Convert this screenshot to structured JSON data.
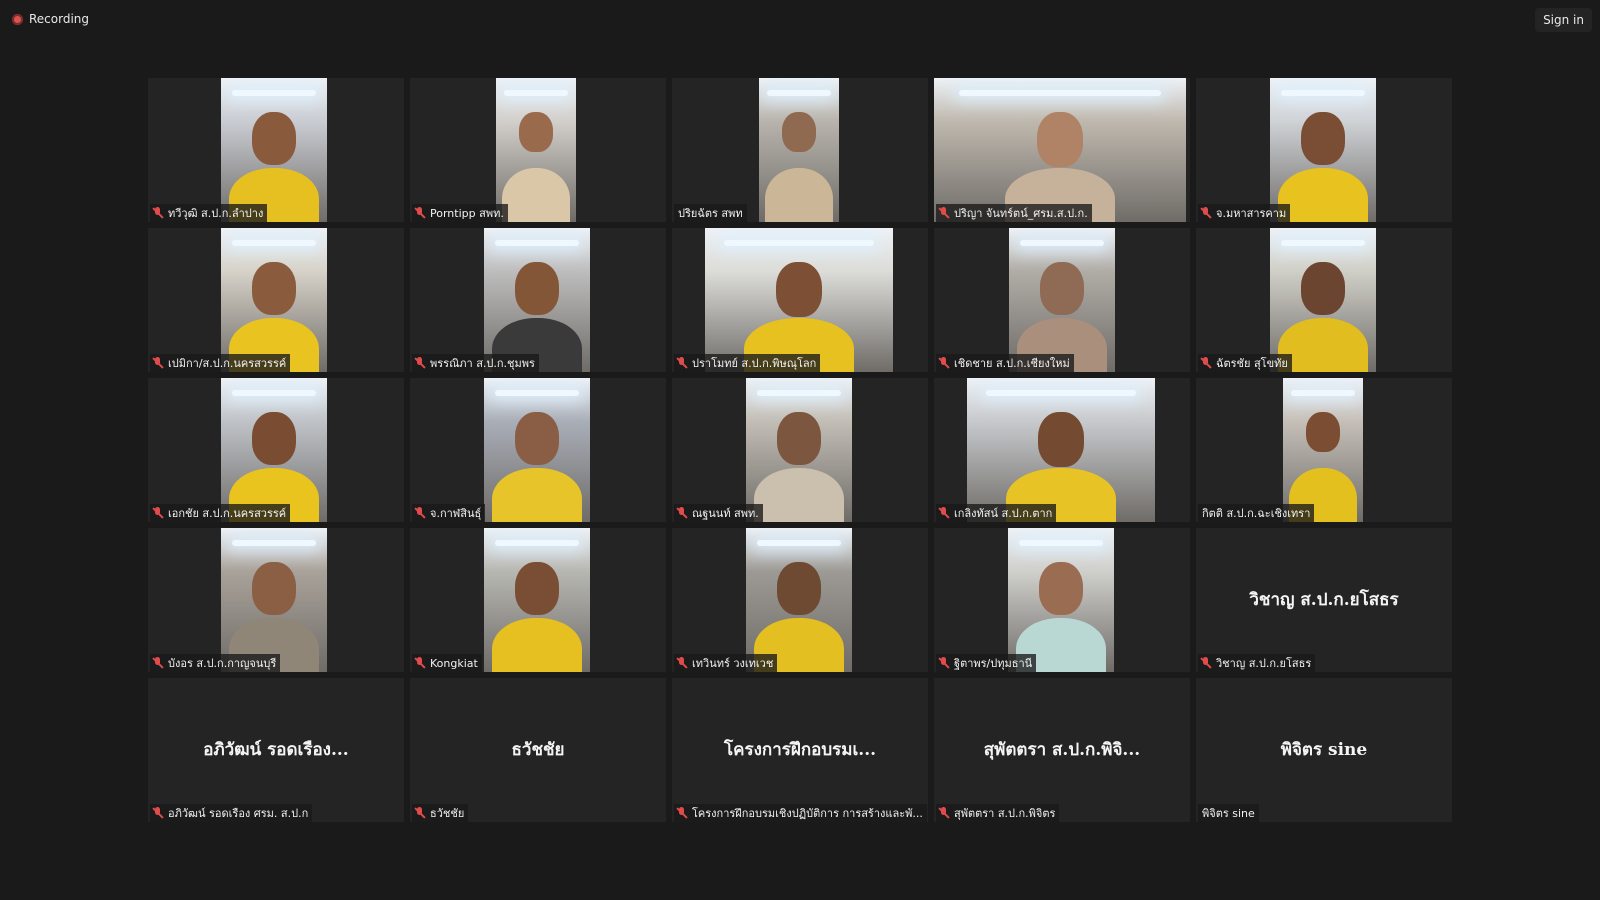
{
  "topbar": {
    "recording_label": "Recording",
    "signin_label": "Sign in"
  },
  "colors": {
    "background": "#1a1a1a",
    "tile": "#242424",
    "mic_muted": "#e04b4b",
    "shirt": "#e6c020"
  },
  "participants": [
    {
      "name": "ทวีวุฒิ ส.ป.ก.ลำปาง",
      "muted": true,
      "video": true
    },
    {
      "name": "Porntipp สพท.",
      "muted": true,
      "video": true
    },
    {
      "name": "ปริยฉัตร สพท",
      "muted": false,
      "video": true
    },
    {
      "name": "ปริญา จันทร์ตน์_ศรม.ส.ป.ก.",
      "muted": true,
      "video": true
    },
    {
      "name": "จ.มหาสารคาม",
      "muted": true,
      "video": true
    },
    {
      "name": "เปมิกา/ส.ป.ก.นครสวรรค์",
      "muted": true,
      "video": true
    },
    {
      "name": "พรรณิภา ส.ป.ก.ชุมพร",
      "muted": true,
      "video": true
    },
    {
      "name": "ปราโมทย์ ส.ป.ก.พิษณุโลก",
      "muted": true,
      "video": true
    },
    {
      "name": "เชิดชาย ส.ป.ก.เชียงใหม่",
      "muted": true,
      "video": true
    },
    {
      "name": "ฉัตรชัย สุโขทัย",
      "muted": true,
      "video": true
    },
    {
      "name": "เอกชัย ส.ป.ก.นครสวรรค์",
      "muted": true,
      "video": true
    },
    {
      "name": "จ.กาฬสินธุ์",
      "muted": true,
      "video": true
    },
    {
      "name": "ณฐนนท์ สพท.",
      "muted": true,
      "video": true
    },
    {
      "name": "เกลิงทัสน์ ส.ป.ก.ตาก",
      "muted": true,
      "video": true
    },
    {
      "name": "กิตติ ส.ป.ก.ฉะเชิงเทรา",
      "muted": false,
      "video": true
    },
    {
      "name": "บังอร ส.ป.ก.กาญจนบุรี",
      "muted": true,
      "video": true
    },
    {
      "name": "Kongkiat",
      "muted": true,
      "video": true
    },
    {
      "name": "เทวินทร์ วงเทเวช",
      "muted": true,
      "video": true
    },
    {
      "name": "ฐิตาพร/ปทุมธานี",
      "muted": true,
      "video": true
    },
    {
      "name": "วิชาญ ส.ป.ก.ยโสธร",
      "muted": true,
      "video": false,
      "display_name": "วิชาญ ส.ป.ก.ยโสธร"
    },
    {
      "name": "อภิวัฒน์ รอดเรือง ศรม. ส.ป.ก",
      "muted": true,
      "video": false,
      "display_name": "อภิวัฒน์ รอดเรือง..."
    },
    {
      "name": "ธวัชชัย",
      "muted": true,
      "video": false,
      "display_name": "ธวัชชัย"
    },
    {
      "name": "โครงการฝึกอบรมเชิงปฏิบัติการ การสร้างและพั...",
      "muted": true,
      "video": false,
      "display_name": "โครงการฝึกอบรมเ..."
    },
    {
      "name": "สุพัตตรา ส.ป.ก.พิจิตร",
      "muted": true,
      "video": false,
      "display_name": "สุพัตตรา ส.ป.ก.พิจิ..."
    },
    {
      "name": "พิจิตร sine",
      "muted": false,
      "video": false,
      "display_name": "พิจิตร sine"
    }
  ]
}
